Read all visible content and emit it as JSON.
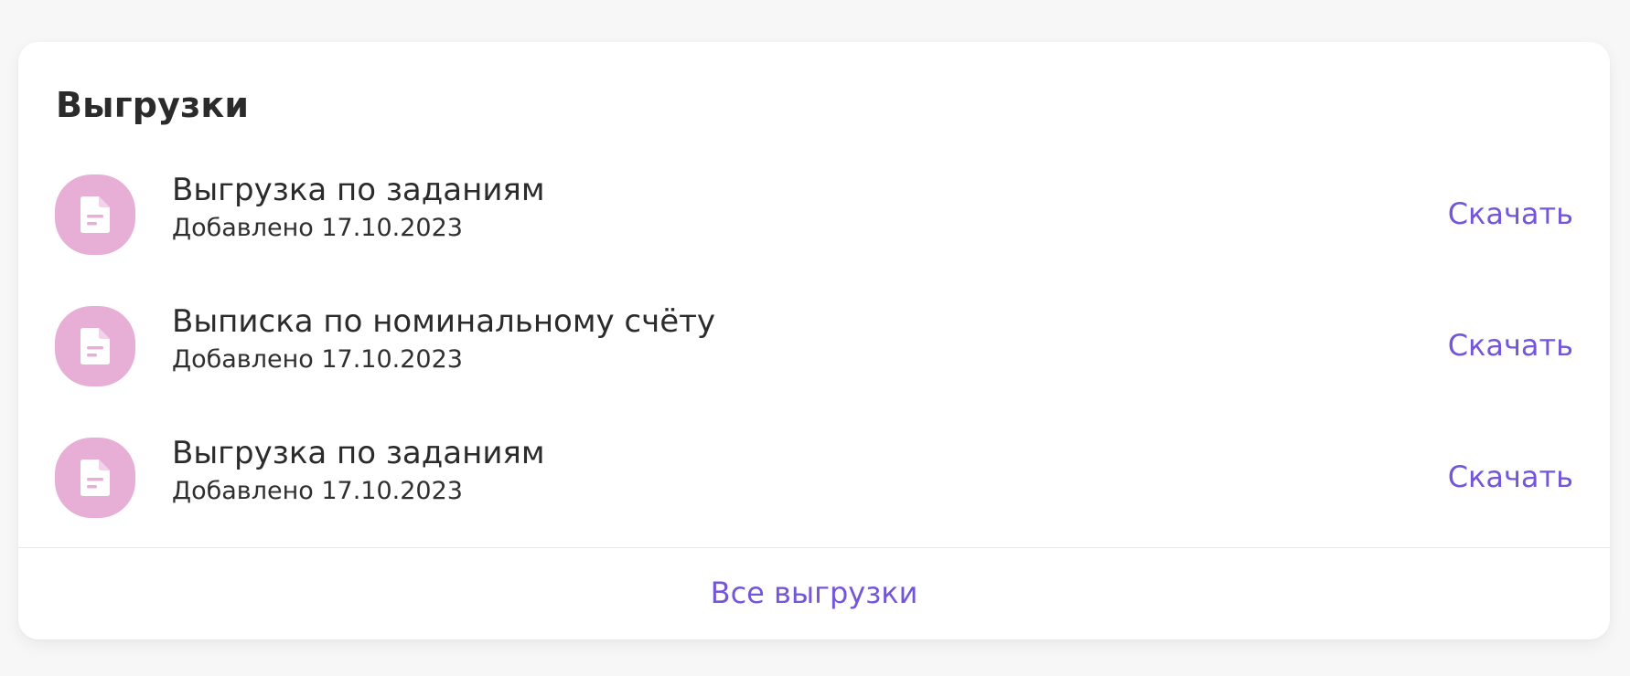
{
  "exports": {
    "title": "Выгрузки",
    "items": [
      {
        "icon": "document-icon",
        "title": "Выгрузка по заданиям",
        "date": "Добавлено 17.10.2023",
        "action": "Скачать"
      },
      {
        "icon": "document-icon",
        "title": "Выписка по номинальному счёту",
        "date": "Добавлено 17.10.2023",
        "action": "Скачать"
      },
      {
        "icon": "document-icon",
        "title": "Выгрузка по заданиям",
        "date": "Добавлено 17.10.2023",
        "action": "Скачать"
      }
    ],
    "all_link": "Все выгрузки"
  },
  "colors": {
    "accent": "#7356d9",
    "icon_background": "#e8afd6",
    "text": "#2b2b2b",
    "page_background": "#f7f7f7"
  }
}
